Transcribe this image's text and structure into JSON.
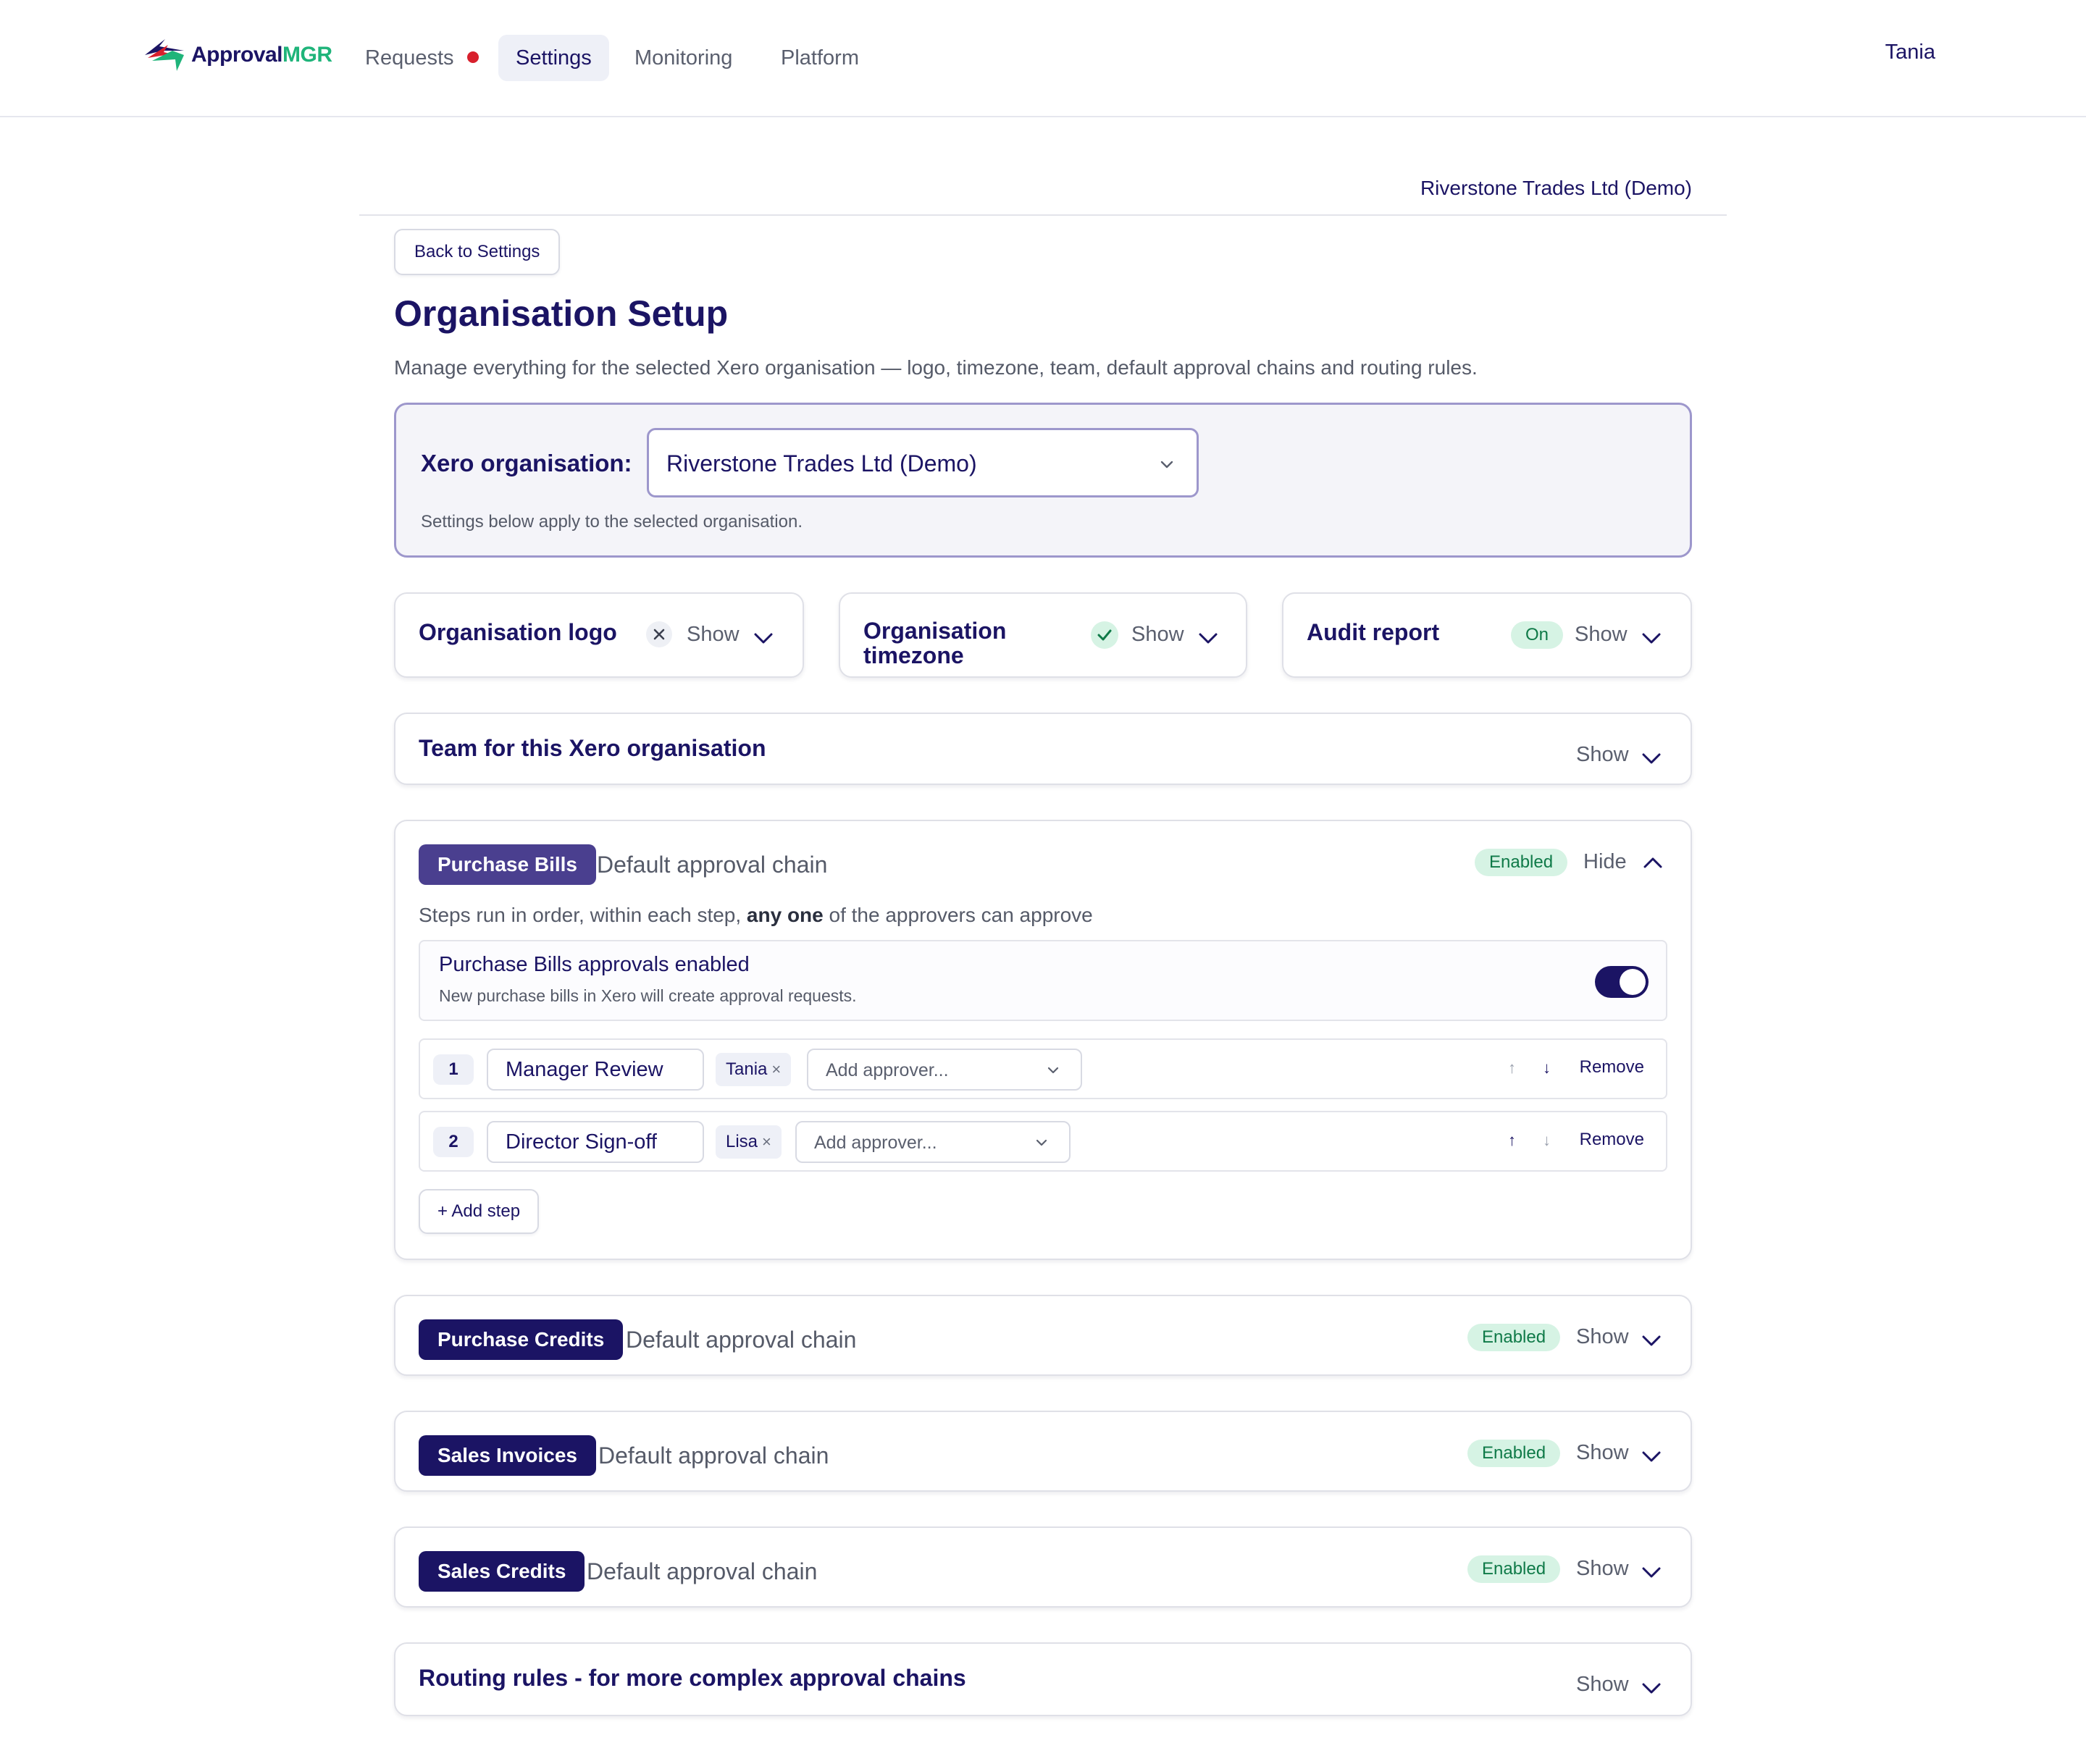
{
  "brand": {
    "name_a": "Approval",
    "name_b": "MGR",
    "primary": "#1b1464",
    "accent": "#1fb47a"
  },
  "nav": {
    "items": [
      {
        "label": "Requests",
        "has_alert": true
      },
      {
        "label": "Settings",
        "active": true
      },
      {
        "label": "Monitoring"
      },
      {
        "label": "Platform"
      }
    ],
    "user": "Tania"
  },
  "header": {
    "org_name": "Riverstone Trades Ltd (Demo)",
    "back_label": "Back to Settings",
    "title": "Organisation Setup",
    "subtitle": "Manage everything for the selected Xero organisation — logo, timezone, team, default approval chains and routing rules."
  },
  "selector": {
    "label": "Xero organisation:",
    "value": "Riverstone Trades Ltd (Demo)",
    "help": "Settings below apply to the selected organisation."
  },
  "small_cards": [
    {
      "title": "Organisation logo",
      "status_icon": "x-icon",
      "toggle": "Show"
    },
    {
      "title_line1": "Organisation",
      "title_line2": "timezone",
      "status_icon": "check-icon",
      "toggle": "Show"
    },
    {
      "title": "Audit report",
      "badge": "On",
      "toggle": "Show"
    }
  ],
  "team_card": {
    "title": "Team for this Xero organisation",
    "toggle": "Show"
  },
  "purchase_bills": {
    "tag": "Purchase Bills",
    "subtitle": "Default approval chain",
    "badge": "Enabled",
    "toggle": "Hide",
    "note_pre": "Steps run in order, within each step, ",
    "note_bold": "any one",
    "note_post": " of the approvers can approve",
    "enabled_title": "Purchase Bills approvals enabled",
    "enabled_desc": "New purchase bills in Xero will create approval requests.",
    "steps": [
      {
        "num": "1",
        "name": "Manager Review",
        "approver": "Tania",
        "placeholder": "Add approver...",
        "remove": "Remove"
      },
      {
        "num": "2",
        "name": "Director Sign-off",
        "approver": "Lisa",
        "placeholder": "Add approver...",
        "remove": "Remove"
      }
    ],
    "add_step": "+ Add step",
    "arrow_up": "↑",
    "arrow_down": "↓",
    "chip_close": "×"
  },
  "chains": [
    {
      "tag": "Purchase Credits",
      "subtitle": "Default approval chain",
      "badge": "Enabled",
      "toggle": "Show"
    },
    {
      "tag": "Sales Invoices",
      "subtitle": "Default approval chain",
      "badge": "Enabled",
      "toggle": "Show"
    },
    {
      "tag": "Sales Credits",
      "subtitle": "Default approval chain",
      "badge": "Enabled",
      "toggle": "Show"
    }
  ],
  "routing_card": {
    "title": "Routing rules - for more complex approval chains",
    "toggle": "Show"
  }
}
